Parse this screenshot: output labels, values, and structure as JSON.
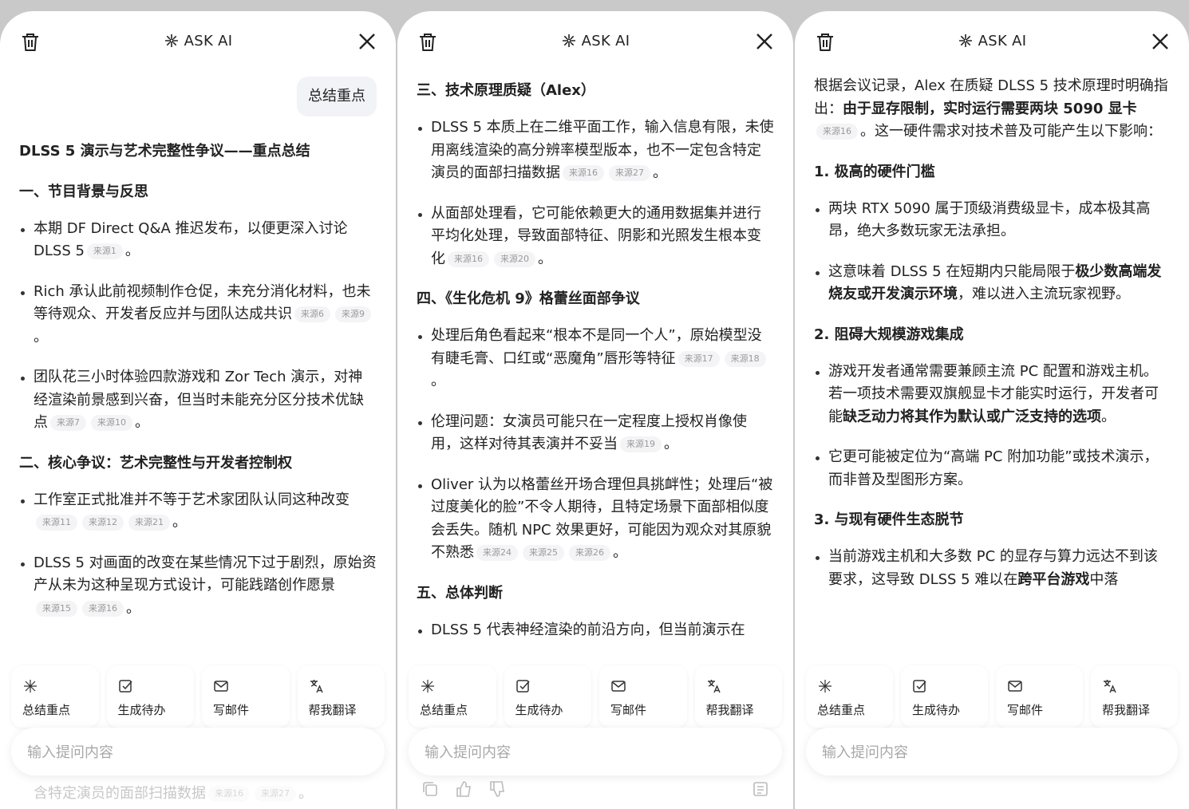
{
  "header": {
    "title": "ASK AI"
  },
  "input": {
    "placeholder": "输入提问内容"
  },
  "actions": [
    "总结重点",
    "生成待办",
    "写邮件",
    "帮我翻译"
  ],
  "panel1": {
    "user_message": "总结重点",
    "doc_title": "DLSS 5 演示与艺术完整性争议——重点总结",
    "s1": {
      "heading": "一、节目背景与反思",
      "b1": {
        "text": "本期 DF Direct Q&A 推迟发布，以便更深入讨论 DLSS 5",
        "src": [
          "来源1"
        ],
        "end": "。"
      },
      "b2": {
        "text": "Rich 承认此前视频制作仓促，未充分消化材料，也未等待观众、开发者反应并与团队达成共识",
        "src": [
          "来源6",
          "来源9"
        ],
        "end": "。"
      },
      "b3": {
        "text": "团队花三小时体验四款游戏和 Zor Tech 演示，对神经渲染前景感到兴奋，但当时未能充分区分技术优缺点",
        "src": [
          "来源7",
          "来源10"
        ],
        "end": "。"
      }
    },
    "s2": {
      "heading": "二、核心争议：艺术完整性与开发者控制权",
      "b1": {
        "text": "工作室正式批准并不等于艺术家团队认同这种改变",
        "src": [
          "来源11",
          "来源12",
          "来源21"
        ],
        "end": "。"
      },
      "b2": {
        "text": "DLSS 5 对画面的改变在某些情况下过于剧烈，原始资产从未为这种呈现方式设计，可能践踏创作愿景",
        "src": [
          "来源15",
          "来源16"
        ],
        "end": "。"
      }
    },
    "ghost": {
      "text": "含特定演员的面部扫描数据",
      "src": [
        "来源16",
        "来源27"
      ],
      "end": "。"
    }
  },
  "panel2": {
    "s3": {
      "heading": "三、技术原理质疑（Alex）",
      "b1": {
        "text": "DLSS 5 本质上在二维平面工作，输入信息有限，未使用离线渲染的高分辨率模型版本，也不一定包含特定演员的面部扫描数据",
        "src": [
          "来源16",
          "来源27"
        ],
        "end": "。"
      },
      "b2": {
        "text": "从面部处理看，它可能依赖更大的通用数据集并进行平均化处理，导致面部特征、阴影和光照发生根本变化",
        "src": [
          "来源16",
          "来源20"
        ],
        "end": "。"
      }
    },
    "s4": {
      "heading": "四、《生化危机 9》格蕾丝面部争议",
      "b1": {
        "text": "处理后角色看起来“根本不是同一个人”，原始模型没有睫毛膏、口红或“恶魔角”唇形等特征",
        "src": [
          "来源17",
          "来源18"
        ],
        "end": "。"
      },
      "b2": {
        "text": "伦理问题：女演员可能只在一定程度上授权肖像使用，这样对待其表演并不妥当",
        "src": [
          "来源19"
        ],
        "end": "。"
      },
      "b3": {
        "text": "Oliver 认为以格蕾丝开场合理但具挑衅性；处理后“被过度美化的脸”不令人期待，且特定场景下面部相似度会丢失。随机 NPC 效果更好，可能因为观众对其原貌不熟悉",
        "src": [
          "来源24",
          "来源25",
          "来源26"
        ],
        "end": "。"
      }
    },
    "s5": {
      "heading": "五、总体判断",
      "b1": {
        "text": "DLSS 5 代表神经渲染的前沿方向，但当前演示在"
      }
    }
  },
  "panel3": {
    "intro": {
      "pre": "根据会议记录，Alex 在质疑 DLSS 5 技术原理时明确指出：",
      "bold": "由于显存限制，实时运行需要两块 5090 显卡",
      "src": [
        "来源16"
      ],
      "post": "。这一硬件需求对技术普及可能产生以下影响："
    },
    "h1": "1. 极高的硬件门槛",
    "h1b1": "两块 RTX 5090 属于顶级消费级显卡，成本极其高昂，绝大多数玩家无法承担。",
    "h1b2": {
      "pre": "这意味着 DLSS 5 在短期内只能局限于",
      "bold": "极少数高端发烧友或开发演示环境",
      "post": "，难以进入主流玩家视野。"
    },
    "h2": "2. 阻碍大规模游戏集成",
    "h2b1": {
      "pre": "游戏开发者通常需要兼顾主流 PC 配置和游戏主机。若一项技术需要双旗舰显卡才能实时运行，开发者可能",
      "bold": "缺乏动力将其作为默认或广泛支持的选项",
      "post": "。"
    },
    "h2b2": "它更可能被定位为“高端 PC 附加功能”或技术演示，而非普及型图形方案。",
    "h3": "3. 与现有硬件生态脱节",
    "h3b1": {
      "pre": "当前游戏主机和大多数 PC 的显存与算力远达不到该要求，这导致 DLSS 5 难以在",
      "bold": "跨平台游戏",
      "post": "中落"
    }
  }
}
